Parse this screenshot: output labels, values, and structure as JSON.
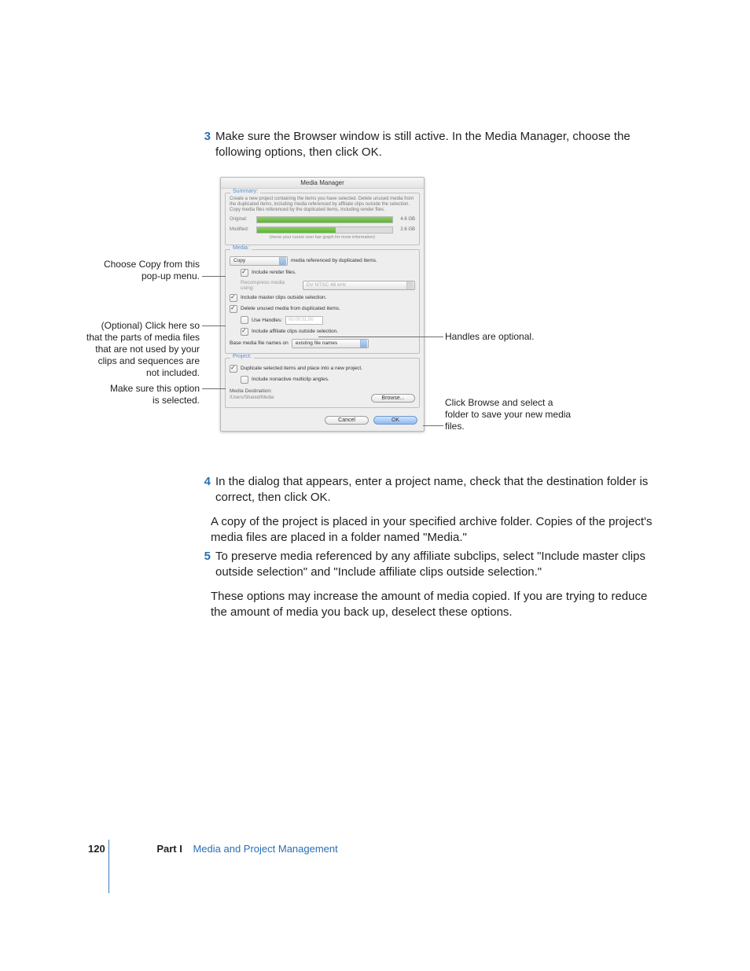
{
  "steps": {
    "s3": {
      "num": "3",
      "text": "Make sure the Browser window is still active. In the Media Manager, choose the following options, then click OK."
    },
    "s4": {
      "num": "4",
      "text": "In the dialog that appears, enter a project name, check that the destination folder is correct, then click OK."
    },
    "s4_follow": "A copy of the project is placed in your specified archive folder. Copies of the project's media files are placed in a folder named \"Media.\"",
    "s5": {
      "num": "5",
      "text": "To preserve media referenced by any affiliate subclips, select \"Include master clips outside selection\" and \"Include affiliate clips outside selection.\""
    },
    "s5_follow": "These options may increase the amount of media copied. If you are trying to reduce the amount of media you back up, deselect these options."
  },
  "dialog": {
    "title": "Media Manager",
    "summary": {
      "title": "Summary:",
      "text": "Create a new project containing the items you have selected. Delete unused media from the duplicated items, including media referenced by affiliate clips outside the selection. Copy media files referenced by the duplicated items, including render files.",
      "original": {
        "label": "Original:",
        "size": "4.6 GB",
        "pct": 100
      },
      "modified": {
        "label": "Modified:",
        "size": "2.6 GB",
        "pct": 58
      },
      "note": "(move your cursor over bar graph for more information)"
    },
    "media": {
      "title": "Media:",
      "action": {
        "value": "Copy",
        "suffix": "media referenced by duplicated items."
      },
      "include_render": "Include render files.",
      "recompress": {
        "label": "Recompress media using:",
        "value": "DV NTSC 48 kHz"
      },
      "include_master": "Include master clips outside selection.",
      "delete_unused": "Delete unused media from duplicated items.",
      "use_handles": {
        "label": "Use Handles:",
        "value": "00:00:01;00"
      },
      "include_affiliate": "Include affiliate clips outside selection.",
      "base_names": {
        "label": "Base media file names on",
        "value": "existing file names"
      }
    },
    "project": {
      "title": "Project:",
      "duplicate": "Duplicate selected items and place into a new project.",
      "nonactive": "Include nonactive multiclip angles.",
      "dest_label": "Media Destination:",
      "dest_path": "/Users/Shared/Media",
      "browse": "Browse..."
    },
    "buttons": {
      "cancel": "Cancel",
      "ok": "OK"
    }
  },
  "callouts": {
    "c1": "Choose Copy from this pop-up menu.",
    "c2": "(Optional) Click here so that the parts of media files that are not used by your clips and sequences are not included.",
    "c3": "Make sure this option is selected.",
    "c4": "Handles are optional.",
    "c5": "Click Browse and select a folder to save your new media files."
  },
  "footer": {
    "page": "120",
    "part": "Part I",
    "title": "Media and Project Management"
  }
}
